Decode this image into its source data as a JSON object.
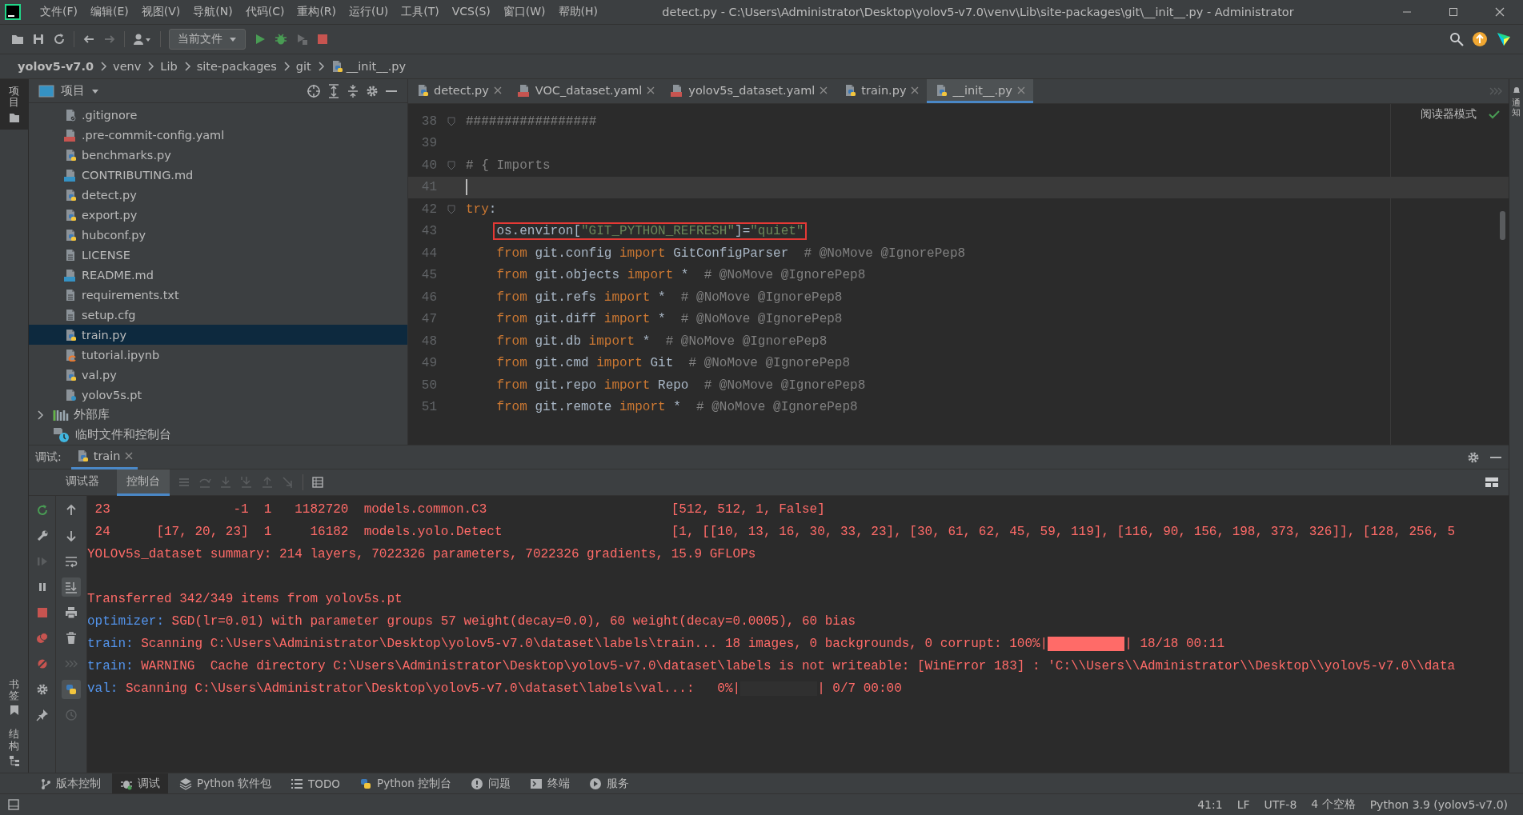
{
  "title_bar": {
    "menu": [
      "文件(F)",
      "编辑(E)",
      "视图(V)",
      "导航(N)",
      "代码(C)",
      "重构(R)",
      "运行(U)",
      "工具(T)",
      "VCS(S)",
      "窗口(W)",
      "帮助(H)"
    ],
    "title": "detect.py - C:\\Users\\Administrator\\Desktop\\yolov5-v7.0\\venv\\Lib\\site-packages\\git\\__init__.py - Administrator"
  },
  "toolbar": {
    "run_config": "当前文件"
  },
  "breadcrumb": [
    {
      "label": "yolov5-v7.0",
      "kind": "root"
    },
    {
      "label": "venv",
      "kind": "folder"
    },
    {
      "label": "Lib",
      "kind": "folder"
    },
    {
      "label": "site-packages",
      "kind": "folder"
    },
    {
      "label": "git",
      "kind": "folder"
    },
    {
      "label": "__init__.py",
      "kind": "python"
    }
  ],
  "left_stripe": {
    "top": [
      {
        "label": "项目",
        "kind": "project",
        "selected": true
      }
    ],
    "bottom": [
      {
        "label": "书签",
        "kind": "bookmarks",
        "selected": false
      },
      {
        "label": "结构",
        "kind": "structure",
        "selected": false
      }
    ]
  },
  "right_stripe": [
    {
      "label": "通知",
      "kind": "notifications"
    }
  ],
  "project": {
    "title": "项目",
    "items": [
      {
        "label": ".gitignore",
        "kind": "ignore",
        "selected": false
      },
      {
        "label": ".pre-commit-config.yaml",
        "kind": "yaml",
        "selected": false
      },
      {
        "label": "benchmarks.py",
        "kind": "python",
        "selected": false
      },
      {
        "label": "CONTRIBUTING.md",
        "kind": "markdown",
        "selected": false
      },
      {
        "label": "detect.py",
        "kind": "python",
        "selected": false
      },
      {
        "label": "export.py",
        "kind": "python",
        "selected": false
      },
      {
        "label": "hubconf.py",
        "kind": "python",
        "selected": false
      },
      {
        "label": "LICENSE",
        "kind": "text",
        "selected": false
      },
      {
        "label": "README.md",
        "kind": "markdown",
        "selected": false
      },
      {
        "label": "requirements.txt",
        "kind": "text",
        "selected": false
      },
      {
        "label": "setup.cfg",
        "kind": "text",
        "selected": false
      },
      {
        "label": "train.py",
        "kind": "python",
        "selected": true
      },
      {
        "label": "tutorial.ipynb",
        "kind": "notebook",
        "selected": false
      },
      {
        "label": "val.py",
        "kind": "python",
        "selected": false
      },
      {
        "label": "yolov5s.pt",
        "kind": "unknown",
        "selected": false
      }
    ],
    "groups": [
      {
        "label": "外部库",
        "kind": "library",
        "expanded": false
      },
      {
        "label": "临时文件和控制台",
        "kind": "scratch"
      }
    ]
  },
  "editor": {
    "tabs": [
      {
        "label": "detect.py",
        "kind": "python",
        "selected": false
      },
      {
        "label": "VOC_dataset.yaml",
        "kind": "yaml",
        "selected": false
      },
      {
        "label": "yolov5s_dataset.yaml",
        "kind": "yaml",
        "selected": false
      },
      {
        "label": "train.py",
        "kind": "python",
        "selected": false
      },
      {
        "label": "__init__.py",
        "kind": "python",
        "selected": true
      }
    ],
    "reader_mode": "阅读器模式",
    "lines": [
      {
        "number": "38",
        "fold": true,
        "current": false,
        "boxed": false,
        "tokens": [
          {
            "kind": "comment",
            "text": "#################"
          }
        ]
      },
      {
        "number": "39",
        "fold": false,
        "current": false,
        "boxed": false
      },
      {
        "number": "40",
        "fold": true,
        "current": false,
        "boxed": false,
        "tokens": [
          {
            "kind": "comment",
            "text": "# { Imports"
          }
        ]
      },
      {
        "number": "41",
        "fold": false,
        "current": true,
        "boxed": false
      },
      {
        "number": "42",
        "fold": true,
        "current": false,
        "boxed": false,
        "tokens": [
          {
            "kind": "keyword",
            "text": "try"
          },
          {
            "kind": "plain",
            "text": ":"
          }
        ]
      },
      {
        "number": "43",
        "fold": false,
        "current": false,
        "boxed": true,
        "indented": true,
        "tokens": [
          {
            "kind": "plain",
            "text": "os.environ["
          },
          {
            "kind": "string",
            "text": "\"GIT_PYTHON_REFRESH\""
          },
          {
            "kind": "plain",
            "text": "]="
          },
          {
            "kind": "string",
            "text": "\"quiet\""
          }
        ]
      },
      {
        "number": "44",
        "fold": false,
        "current": false,
        "boxed": false,
        "indented": true,
        "tokens": [
          {
            "kind": "keyword",
            "text": "from"
          },
          {
            "kind": "plain",
            "text": " git.config "
          },
          {
            "kind": "keyword",
            "text": "import"
          },
          {
            "kind": "plain",
            "text": " GitConfigParser  "
          },
          {
            "kind": "comment",
            "text": "# @NoMove @IgnorePep8"
          }
        ]
      },
      {
        "number": "45",
        "fold": false,
        "current": false,
        "boxed": false,
        "indented": true,
        "tokens": [
          {
            "kind": "keyword",
            "text": "from"
          },
          {
            "kind": "plain",
            "text": " git.objects "
          },
          {
            "kind": "keyword",
            "text": "import"
          },
          {
            "kind": "plain",
            "text": " *  "
          },
          {
            "kind": "comment",
            "text": "# @NoMove @IgnorePep8"
          }
        ]
      },
      {
        "number": "46",
        "fold": false,
        "current": false,
        "boxed": false,
        "indented": true,
        "tokens": [
          {
            "kind": "keyword",
            "text": "from"
          },
          {
            "kind": "plain",
            "text": " git.refs "
          },
          {
            "kind": "keyword",
            "text": "import"
          },
          {
            "kind": "plain",
            "text": " *  "
          },
          {
            "kind": "comment",
            "text": "# @NoMove @IgnorePep8"
          }
        ]
      },
      {
        "number": "47",
        "fold": false,
        "current": false,
        "boxed": false,
        "indented": true,
        "tokens": [
          {
            "kind": "keyword",
            "text": "from"
          },
          {
            "kind": "plain",
            "text": " git.diff "
          },
          {
            "kind": "keyword",
            "text": "import"
          },
          {
            "kind": "plain",
            "text": " *  "
          },
          {
            "kind": "comment",
            "text": "# @NoMove @IgnorePep8"
          }
        ]
      },
      {
        "number": "48",
        "fold": false,
        "current": false,
        "boxed": false,
        "indented": true,
        "tokens": [
          {
            "kind": "keyword",
            "text": "from"
          },
          {
            "kind": "plain",
            "text": " git.db "
          },
          {
            "kind": "keyword",
            "text": "import"
          },
          {
            "kind": "plain",
            "text": " *  "
          },
          {
            "kind": "comment",
            "text": "# @NoMove @IgnorePep8"
          }
        ]
      },
      {
        "number": "49",
        "fold": false,
        "current": false,
        "boxed": false,
        "indented": true,
        "tokens": [
          {
            "kind": "keyword",
            "text": "from"
          },
          {
            "kind": "plain",
            "text": " git.cmd "
          },
          {
            "kind": "keyword",
            "text": "import"
          },
          {
            "kind": "plain",
            "text": " Git  "
          },
          {
            "kind": "comment",
            "text": "# @NoMove @IgnorePep8"
          }
        ]
      },
      {
        "number": "50",
        "fold": false,
        "current": false,
        "boxed": false,
        "indented": true,
        "tokens": [
          {
            "kind": "keyword",
            "text": "from"
          },
          {
            "kind": "plain",
            "text": " git.repo "
          },
          {
            "kind": "keyword",
            "text": "import"
          },
          {
            "kind": "plain",
            "text": " Repo  "
          },
          {
            "kind": "comment",
            "text": "# @NoMove @IgnorePep8"
          }
        ]
      },
      {
        "number": "51",
        "fold": false,
        "current": false,
        "boxed": false,
        "indented": true,
        "tokens": [
          {
            "kind": "keyword",
            "text": "from"
          },
          {
            "kind": "plain",
            "text": " git.remote "
          },
          {
            "kind": "keyword",
            "text": "import"
          },
          {
            "kind": "plain",
            "text": " *  "
          },
          {
            "kind": "comment",
            "text": "# @NoMove @IgnorePep8"
          }
        ]
      }
    ]
  },
  "debug": {
    "title": "调试:",
    "run_tab": "train",
    "subtabs": [
      {
        "label": "调试器",
        "selected": false
      },
      {
        "label": "控制台",
        "selected": true
      }
    ],
    "console": [
      {
        "kind": "plain",
        "text": " 23                -1  1   1182720  models.common.C3                        [512, 512, 1, False]"
      },
      {
        "kind": "plain",
        "text": " 24      [17, 20, 23]  1     16182  models.yolo.Detect                      [1, [[10, 13, 16, 30, 33, 23], [30, 61, 62, 45, 59, 119], [116, 90, 156, 198, 373, 326]], [128, 256, 5"
      },
      {
        "kind": "plain",
        "text": "YOLOv5s_dataset summary: 214 layers, 7022326 parameters, 7022326 gradients, 15.9 GFLOPs"
      },
      {
        "kind": "blank"
      },
      {
        "kind": "plain",
        "text": "Transferred 342/349 items from yolov5s.pt"
      },
      {
        "kind": "prefixed",
        "prefix": "optimizer:",
        "text": " SGD(lr=0.01) with parameter groups 57 weight(decay=0.0), 60 weight(decay=0.0005), 60 bias"
      },
      {
        "kind": "progress",
        "prefix": "train:",
        "text": " Scanning C:\\Users\\Administrator\\Desktop\\yolov5-v7.0\\dataset\\labels\\train... 18 images, 0 backgrounds, 0 corrupt: 100%|",
        "level": 1,
        "after": "| 18/18 00:11"
      },
      {
        "kind": "prefixed",
        "prefix": "train:",
        "text": " WARNING  Cache directory C:\\Users\\Administrator\\Desktop\\yolov5-v7.0\\dataset\\labels is not writeable: [WinError 183] : 'C:\\\\Users\\\\Administrator\\\\Desktop\\\\yolov5-v7.0\\\\data"
      },
      {
        "kind": "progress",
        "prefix": "val:",
        "text": " Scanning C:\\Users\\Administrator\\Desktop\\yolov5-v7.0\\dataset\\labels\\val...:   0%|",
        "level": 0,
        "after": "| 0/7 00:00"
      }
    ]
  },
  "bottom_tools": [
    {
      "label": "版本控制",
      "kind": "vcs",
      "selected": false
    },
    {
      "label": "调试",
      "kind": "debug",
      "selected": true
    },
    {
      "label": "Python 软件包",
      "kind": "packages",
      "selected": false
    },
    {
      "label": "TODO",
      "kind": "todo",
      "selected": false
    },
    {
      "label": "Python 控制台",
      "kind": "python",
      "selected": false
    },
    {
      "label": "问题",
      "kind": "problems",
      "selected": false
    },
    {
      "label": "终端",
      "kind": "terminal",
      "selected": false
    },
    {
      "label": "服务",
      "kind": "services",
      "selected": false
    }
  ],
  "status_bar": {
    "items": [
      "41:1",
      "LF",
      "UTF-8",
      "4 个空格",
      "Python 3.9 (yolov5-v7.0)"
    ]
  }
}
